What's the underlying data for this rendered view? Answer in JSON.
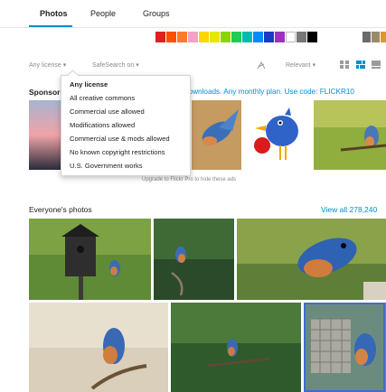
{
  "tabs": [
    {
      "label": "Photos"
    },
    {
      "label": "People"
    },
    {
      "label": "Groups"
    }
  ],
  "color_swatches": [
    "#e02020",
    "#ff4e00",
    "#ff7a2a",
    "#f7a0c7",
    "#ffd500",
    "#e7e600",
    "#8fd400",
    "#1dcc56",
    "#00b9b0",
    "#008cff",
    "#1a3cc2",
    "#a030c4",
    "#ffffff",
    "#777777",
    "#000000"
  ],
  "filters": {
    "license": "Any license ▾",
    "safesearch": "SafeSearch on ▾",
    "sort": "Relevant ▾"
  },
  "sponsored": {
    "label": "Sponsored",
    "promo": "downloads. Any monthly plan. Use code: FLICKR10",
    "upgrade": "Upgrade to Flickr Pro to hide these ads"
  },
  "license_menu": {
    "items": [
      "Any license",
      "All creative commons",
      "Commercial use allowed",
      "Modifications allowed",
      "Commercial use & mods allowed",
      "No known copyright restrictions",
      "U.S. Government works"
    ]
  },
  "everyone": {
    "title": "Everyone's photos",
    "view_all": "View all 278,240"
  },
  "icons": [
    "share-icon",
    "grid-icon",
    "justified-view-icon",
    "list-view-icon",
    "chevron-down-icon"
  ]
}
